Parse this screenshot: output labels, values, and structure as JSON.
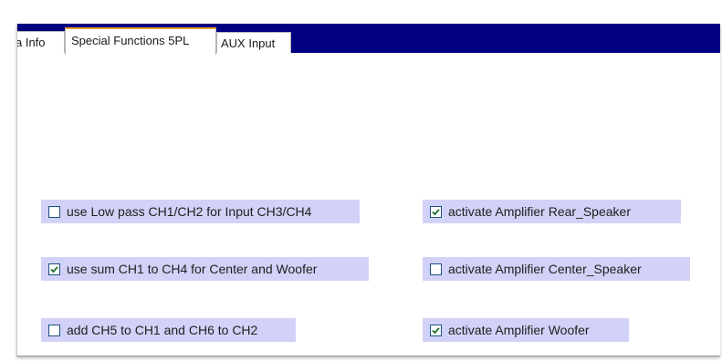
{
  "tabs": [
    {
      "label": "a Info"
    },
    {
      "label": "Special Functions 5PL"
    },
    {
      "label": "AUX Input"
    }
  ],
  "options": [
    {
      "label": "use Low pass CH1/CH2 for Input CH3/CH4",
      "checked": false
    },
    {
      "label": "use sum CH1 to CH4 for Center and Woofer",
      "checked": true
    },
    {
      "label": "add CH5 to CH1 and CH6 to CH2",
      "checked": false
    },
    {
      "label": "activate Amplifier Rear_Speaker",
      "checked": true
    },
    {
      "label": "activate Amplifier Center_Speaker",
      "checked": false
    },
    {
      "label": "activate Amplifier Woofer",
      "checked": true
    }
  ],
  "colors": {
    "tabbar": "#000080",
    "option_bg": "#d2d2f8",
    "active_tab_accent": "#e8a030",
    "check": "#1c6e2a"
  }
}
